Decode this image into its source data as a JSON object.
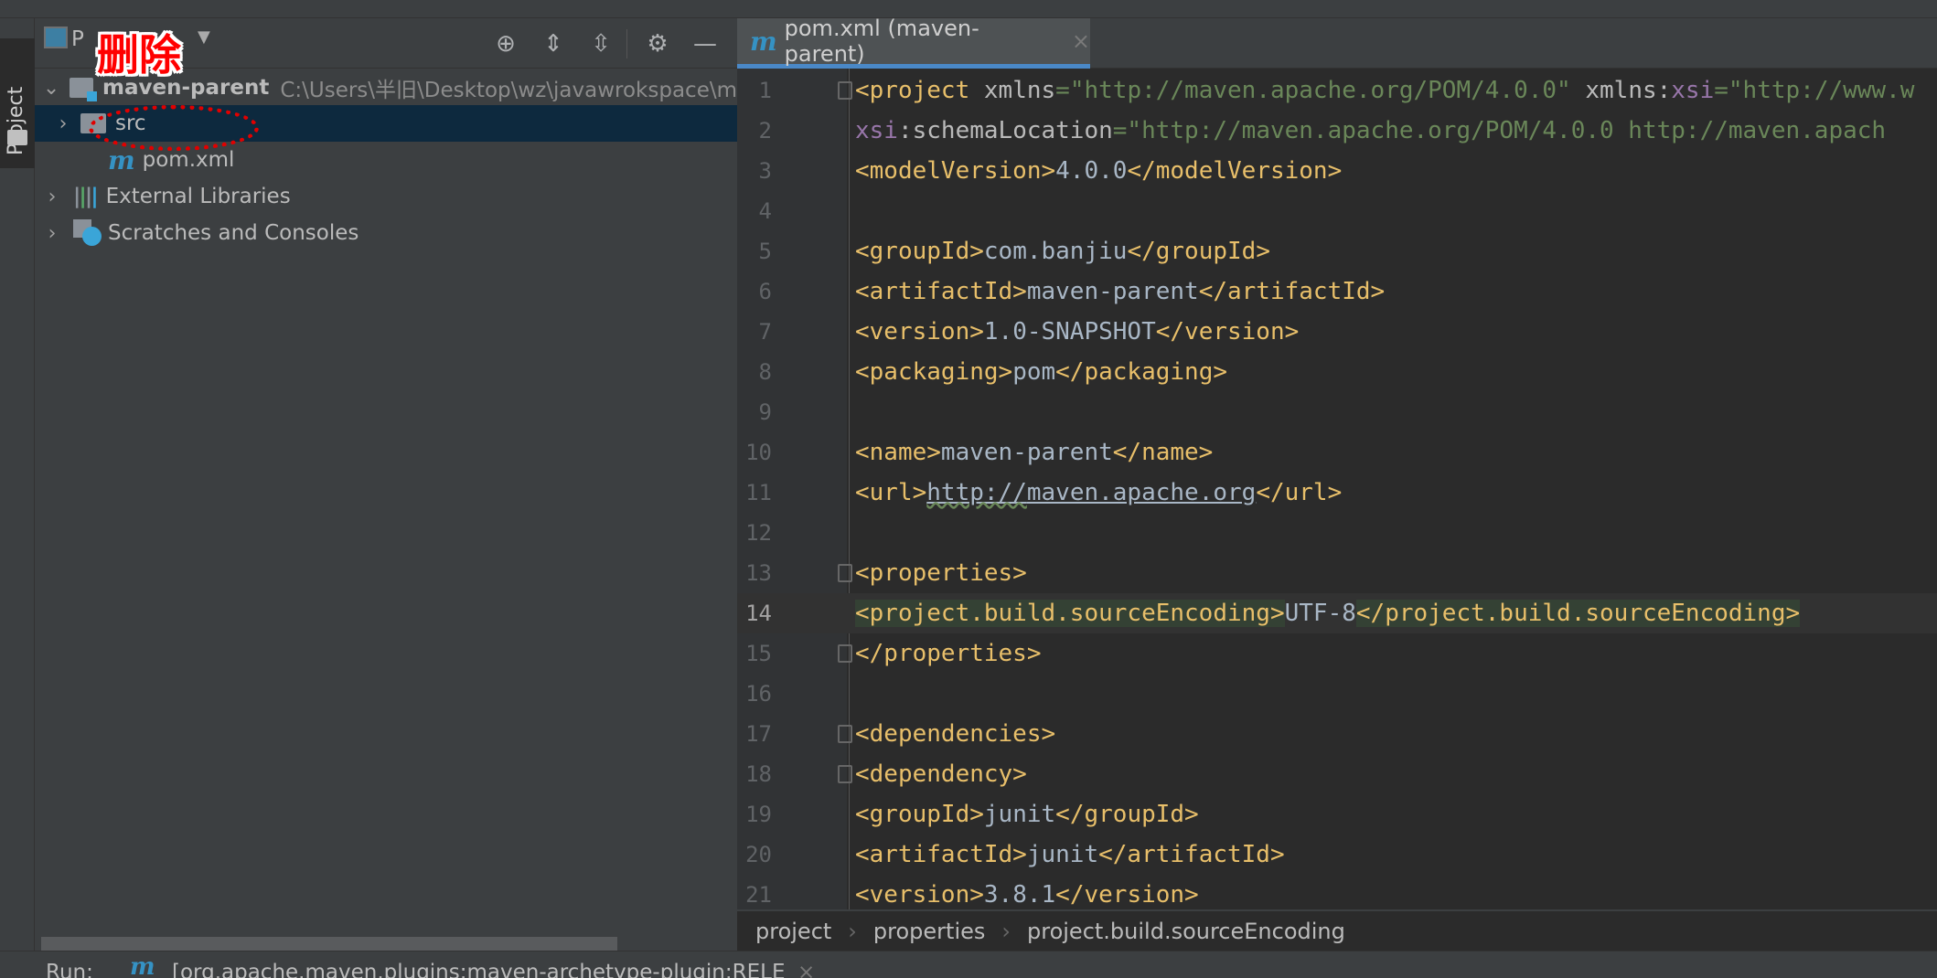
{
  "left_stripe": {
    "label": "Project"
  },
  "annotation": {
    "text": "删除",
    "color": "#ff0000"
  },
  "project_panel": {
    "view_label": "P",
    "toolbar": [
      "locate-icon",
      "expand-all-icon",
      "collapse-all-icon",
      "gear-icon",
      "minimize-icon"
    ],
    "tree": [
      {
        "label": "maven-parent",
        "path": "C:\\Users\\半旧\\Desktop\\wz\\javawrokspace\\m",
        "expanded": true
      },
      {
        "label": "src",
        "selected": true
      },
      {
        "label": "pom.xml"
      },
      {
        "label": "External Libraries"
      },
      {
        "label": "Scratches and Consoles"
      }
    ]
  },
  "editor": {
    "tab": {
      "label": "pom.xml (maven-parent)",
      "close": "×"
    },
    "current_line": 14,
    "lines": [
      [
        [
          "tag",
          "<project "
        ],
        [
          "attr",
          "xmlns"
        ],
        [
          "str",
          "=\"http://maven.apache.org/POM/4.0.0\" "
        ],
        [
          "attr",
          "xmlns:"
        ],
        [
          "ns",
          "xsi"
        ],
        [
          "str",
          "=\"http://www.w"
        ]
      ],
      [
        [
          "txt",
          "  "
        ],
        [
          "ns",
          "xsi"
        ],
        [
          "attr",
          ":schemaLocation"
        ],
        [
          "str",
          "=\"http://maven.apache.org/POM/4.0.0 http://maven.apach"
        ]
      ],
      [
        [
          "txt",
          "  "
        ],
        [
          "tag",
          "<modelVersion>"
        ],
        [
          "val",
          "4.0.0"
        ],
        [
          "tag",
          "</modelVersion>"
        ]
      ],
      [],
      [
        [
          "txt",
          "  "
        ],
        [
          "tag",
          "<groupId>"
        ],
        [
          "val",
          "com.banjiu"
        ],
        [
          "tag",
          "</groupId>"
        ]
      ],
      [
        [
          "txt",
          "  "
        ],
        [
          "tag",
          "<artifactId>"
        ],
        [
          "val",
          "maven-parent"
        ],
        [
          "tag",
          "</artifactId>"
        ]
      ],
      [
        [
          "txt",
          "  "
        ],
        [
          "tag",
          "<version>"
        ],
        [
          "val",
          "1.0-SNAPSHOT"
        ],
        [
          "tag",
          "</version>"
        ]
      ],
      [
        [
          "txt",
          "  "
        ],
        [
          "tag",
          "<packaging>"
        ],
        [
          "val",
          "pom"
        ],
        [
          "tag",
          "</packaging>"
        ]
      ],
      [],
      [
        [
          "txt",
          "  "
        ],
        [
          "tag",
          "<name>"
        ],
        [
          "val",
          "maven-parent"
        ],
        [
          "tag",
          "</name>"
        ]
      ],
      [
        [
          "txt",
          "  "
        ],
        [
          "tag",
          "<url>"
        ],
        [
          "link",
          "http://maven.apache.org"
        ],
        [
          "tag",
          "</url>"
        ]
      ],
      [],
      [
        [
          "txt",
          "  "
        ],
        [
          "tag",
          "<properties>"
        ]
      ],
      [
        [
          "txt",
          "    "
        ],
        [
          "taghl",
          "<project.build.sourceEncoding>"
        ],
        [
          "val",
          "UTF-8"
        ],
        [
          "taghl",
          "</project.build.sourceEncoding>"
        ]
      ],
      [
        [
          "txt",
          "  "
        ],
        [
          "tag",
          "</properties>"
        ]
      ],
      [],
      [
        [
          "txt",
          "  "
        ],
        [
          "tag",
          "<dependencies>"
        ]
      ],
      [
        [
          "txt",
          "    "
        ],
        [
          "tag",
          "<dependency>"
        ]
      ],
      [
        [
          "txt",
          "      "
        ],
        [
          "tag",
          "<groupId>"
        ],
        [
          "val",
          "junit"
        ],
        [
          "tag",
          "</groupId>"
        ]
      ],
      [
        [
          "txt",
          "      "
        ],
        [
          "tag",
          "<artifactId>"
        ],
        [
          "val",
          "junit"
        ],
        [
          "tag",
          "</artifactId>"
        ]
      ],
      [
        [
          "txt",
          "      "
        ],
        [
          "tag",
          "<version>"
        ],
        [
          "val",
          "3.8.1"
        ],
        [
          "tag",
          "</version>"
        ]
      ]
    ],
    "fold_lines": [
      1,
      13,
      15,
      17,
      18
    ],
    "breadcrumbs": [
      "project",
      "properties",
      "project.build.sourceEncoding"
    ]
  },
  "run_bar": {
    "label": "Run:",
    "config": "[org.apache.maven.plugins:maven-archetype-plugin:RELE",
    "close": "×"
  }
}
